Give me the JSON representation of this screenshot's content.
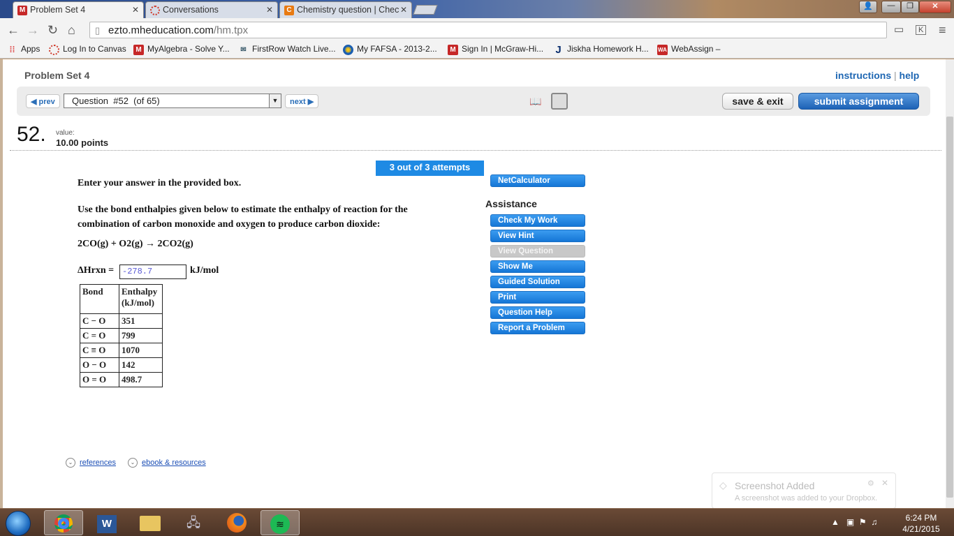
{
  "browser": {
    "tabs": [
      {
        "label": "Problem Set 4",
        "favicon": "M"
      },
      {
        "label": "Conversations",
        "favicon": ""
      },
      {
        "label": "Chemistry question | Chec",
        "favicon": "C"
      }
    ],
    "url_host": "ezto.mheducation.com",
    "url_path": "/hm.tpx",
    "bookmarks": [
      {
        "label": "Apps"
      },
      {
        "label": "Log In to Canvas"
      },
      {
        "label": "MyAlgebra - Solve Y..."
      },
      {
        "label": "FirstRow Watch Live..."
      },
      {
        "label": "My FAFSA - 2013-2..."
      },
      {
        "label": "Sign In | McGraw-Hi..."
      },
      {
        "label": "Jiskha Homework H..."
      },
      {
        "label": "WebAssign –"
      }
    ]
  },
  "page": {
    "title": "Problem Set 4",
    "instructions": "instructions",
    "separator": "|",
    "help": "help",
    "prev": "prev",
    "next": "next",
    "question_select": "Question  #52  (of 65)",
    "save_exit": "save & exit",
    "submit": "submit assignment",
    "question_number": "52.",
    "value_label": "value:",
    "points": "10.00 points",
    "attempts": "3 out of 3 attempts",
    "instruction_text": "Enter your answer in the provided box.",
    "question_text_1": "Use the bond enthalpies given below to estimate the enthalpy of reaction for the",
    "question_text_2": "combination of carbon monoxide and oxygen to produce carbon dioxide:",
    "equation": "2CO(g) + O2(g) → 2CO2(g)",
    "delta_label": "ΔHrxn =",
    "answer_value": "-278.7",
    "unit": "kJ/mol",
    "table": {
      "headers": [
        "Bond",
        "Enthalpy (kJ/mol)"
      ],
      "rows": [
        [
          "C − O",
          "351"
        ],
        [
          "C = O",
          "799"
        ],
        [
          "C ≡ O",
          "1070"
        ],
        [
          "O − O",
          "142"
        ],
        [
          "O = O",
          "498.7"
        ]
      ]
    },
    "netcalc": "NetCalculator",
    "assistance_title": "Assistance",
    "assistance": [
      {
        "label": "Check My Work",
        "enabled": true
      },
      {
        "label": "View Hint",
        "enabled": true
      },
      {
        "label": "View Question",
        "enabled": false
      },
      {
        "label": "Show Me",
        "enabled": true
      },
      {
        "label": "Guided Solution",
        "enabled": true
      },
      {
        "label": "Print",
        "enabled": true
      },
      {
        "label": "Question Help",
        "enabled": true
      },
      {
        "label": "Report a Problem",
        "enabled": true
      }
    ],
    "references": "references",
    "ebook": "ebook & resources"
  },
  "toast": {
    "title": "Screenshot Added",
    "body": "A screenshot was added to your Dropbox."
  },
  "taskbar": {
    "time": "6:24 PM",
    "date": "4/21/2015"
  }
}
